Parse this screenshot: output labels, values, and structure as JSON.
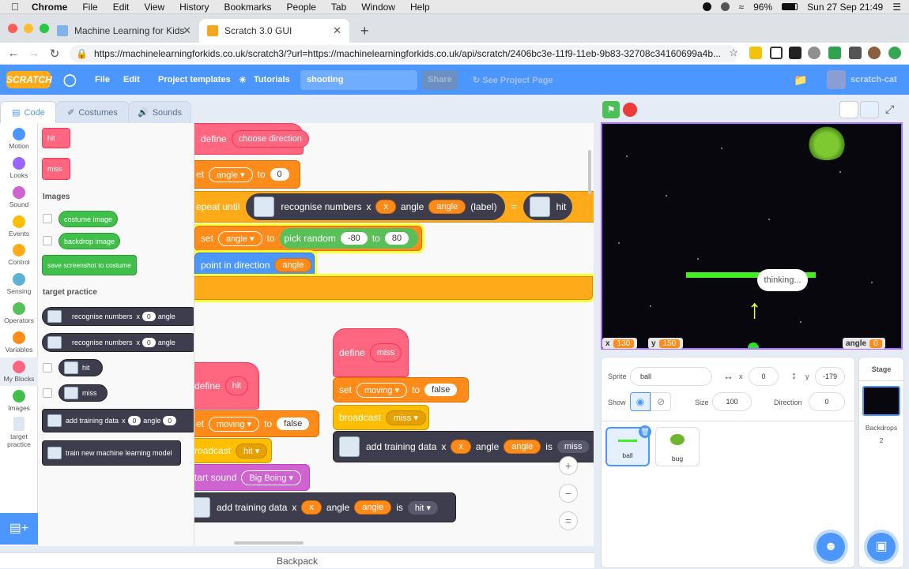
{
  "mac": {
    "app": "Chrome",
    "menus": [
      "File",
      "Edit",
      "View",
      "History",
      "Bookmarks",
      "People",
      "Tab",
      "Window",
      "Help"
    ],
    "battery": "96%",
    "datetime": "Sun 27 Sep  21:49"
  },
  "browser": {
    "tabs": [
      {
        "title": "Machine Learning for Kids"
      },
      {
        "title": "Scratch 3.0 GUI"
      }
    ],
    "url": "https://machinelearningforkids.co.uk/scratch3/?url=https://machinelearningforkids.co.uk/api/scratch/2406bc3e-11f9-11eb-9b83-32708c34160699a4b..."
  },
  "scratch_menu": {
    "logo": "SCRATCH",
    "file": "File",
    "edit": "Edit",
    "templates": "Project templates",
    "tutorials": "Tutorials",
    "project_title": "shooting",
    "share": "Share",
    "see_project": "See Project Page",
    "user": "scratch-cat"
  },
  "editor_tabs": {
    "code": "Code",
    "costumes": "Costumes",
    "sounds": "Sounds"
  },
  "categories": [
    {
      "label": "Motion",
      "color": "#4c97ff"
    },
    {
      "label": "Looks",
      "color": "#9966ff"
    },
    {
      "label": "Sound",
      "color": "#cf63cf"
    },
    {
      "label": "Events",
      "color": "#ffbf00"
    },
    {
      "label": "Control",
      "color": "#ffab19"
    },
    {
      "label": "Sensing",
      "color": "#5cb1d6"
    },
    {
      "label": "Operators",
      "color": "#59c059"
    },
    {
      "label": "Variables",
      "color": "#ff8c1a"
    },
    {
      "label": "My Blocks",
      "color": "#ff6680"
    },
    {
      "label": "Images",
      "color": "#40bf4a"
    },
    {
      "label": "target practice",
      "color": ""
    }
  ],
  "palette": {
    "myblocks": [
      "hit",
      "miss"
    ],
    "images_heading": "Images",
    "images_blocks": [
      "costume image",
      "backdrop image",
      "save screenshot to costume"
    ],
    "tp_heading": "target practice",
    "recognise_label": "recognise numbers",
    "x_label": "x",
    "angle_label": "angle",
    "zero": "0",
    "hit": "hit",
    "miss": "miss",
    "add_training": "add training data",
    "train_model": "train new machine learning model"
  },
  "script": {
    "define": "define",
    "choose_direction": "choose direction",
    "set": "set",
    "angle": "angle",
    "to": "to",
    "zero": "0",
    "repeat_until": "repeat until",
    "recognise": "recognise numbers",
    "x": "x",
    "label": "(label)",
    "eq": "=",
    "hit_trunc": "hit",
    "pick_random": "pick random",
    "neg80": "-80",
    "pos80": "80",
    "point_dir": "point in direction",
    "define_miss": "miss",
    "moving": "moving",
    "false": "false",
    "broadcast": "broadcast",
    "miss": "miss",
    "add_training": "add training data",
    "is": "is",
    "hit": "hit",
    "define_hit": "hit",
    "start_sound": "start sound",
    "big_boing": "Big Boing",
    "set_trunc": "et",
    "broadcast_trunc": "roadcast",
    "start_sound_trunc": "tart sound",
    "repeat_trunc": "epeat until"
  },
  "backpack": "Backpack",
  "stage": {
    "thinking": "thinking...",
    "x_label": "x",
    "x_val": "130",
    "y_label": "y",
    "y_val": "150",
    "angle_label": "angle",
    "angle_val": "0"
  },
  "sprite_info": {
    "sprite_label": "Sprite",
    "sprite_name": "ball",
    "x_label": "x",
    "x_val": "0",
    "y_label": "y",
    "y_val": "-179",
    "show_label": "Show",
    "size_label": "Size",
    "size_val": "100",
    "direction_label": "Direction",
    "direction_val": "0",
    "sprites": [
      "ball",
      "bug"
    ]
  },
  "stage_pane": {
    "title": "Stage",
    "backdrops_label": "Backdrops",
    "backdrops_count": "2"
  }
}
